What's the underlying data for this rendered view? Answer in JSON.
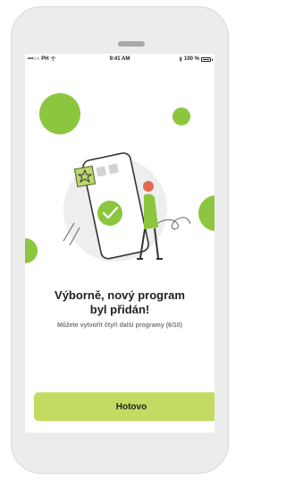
{
  "status_bar": {
    "carrier": "•••○○ PH",
    "time": "9:41 AM",
    "battery": "100 %"
  },
  "content": {
    "title_line1": "Výborně, nový program",
    "title_line2": "byl přidán!",
    "subtitle": "Můžete vytvořit čtyři další programy (6/10)"
  },
  "actions": {
    "done_label": "Hotovo"
  },
  "colors": {
    "accent_green": "#8cc63f",
    "button_green": "#c2dc62"
  },
  "icons": [
    "wifi-icon",
    "bluetooth-icon",
    "battery-icon",
    "star-icon",
    "checkmark-icon"
  ]
}
